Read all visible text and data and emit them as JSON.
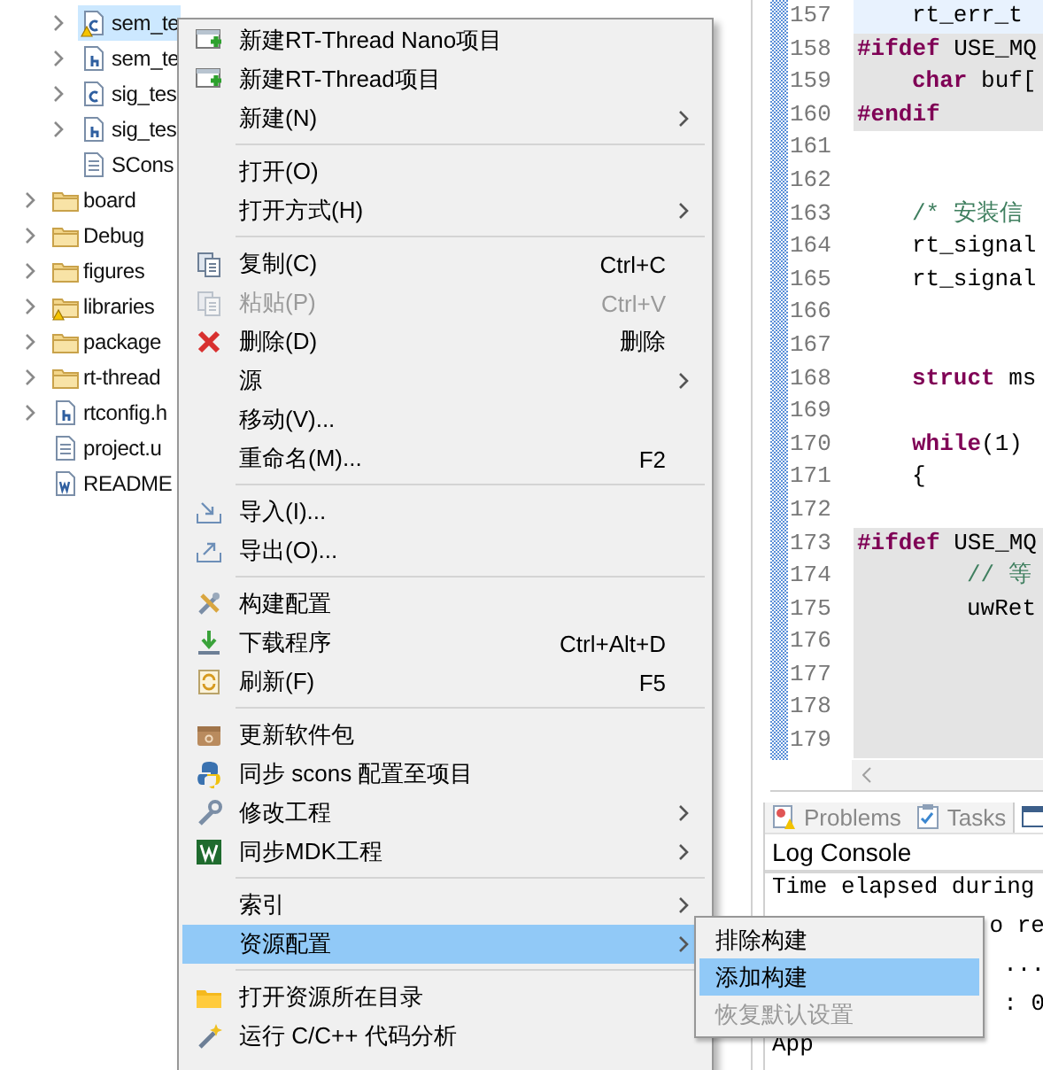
{
  "tree": {
    "open_folder_children": [
      {
        "label": "sem_te",
        "kind": "c-file",
        "warning": true,
        "expandable": true,
        "selected": true
      },
      {
        "label": "sem_te",
        "kind": "h-file",
        "warning": false,
        "expandable": true,
        "selected": false
      },
      {
        "label": "sig_tes",
        "kind": "c-file",
        "warning": false,
        "expandable": true,
        "selected": false
      },
      {
        "label": "sig_tes",
        "kind": "h-file",
        "warning": false,
        "expandable": true,
        "selected": false
      },
      {
        "label": "SCons",
        "kind": "text-file",
        "warning": false,
        "expandable": false,
        "selected": false
      }
    ],
    "items": [
      {
        "label": "board",
        "kind": "folder",
        "warning": false,
        "expandable": true,
        "selected": false
      },
      {
        "label": "Debug",
        "kind": "folder",
        "warning": false,
        "expandable": true,
        "selected": false
      },
      {
        "label": "figures",
        "kind": "folder",
        "warning": false,
        "expandable": true,
        "selected": false
      },
      {
        "label": "libraries",
        "kind": "folder",
        "warning": true,
        "expandable": true,
        "selected": false
      },
      {
        "label": "package",
        "kind": "folder",
        "warning": false,
        "expandable": true,
        "selected": false
      },
      {
        "label": "rt-thread",
        "kind": "folder",
        "warning": false,
        "expandable": true,
        "selected": false
      },
      {
        "label": "rtconfig.h",
        "kind": "h-file",
        "warning": false,
        "expandable": true,
        "selected": false
      },
      {
        "label": "project.u",
        "kind": "text-file",
        "warning": false,
        "expandable": false,
        "selected": false
      },
      {
        "label": "README",
        "kind": "word-file",
        "warning": false,
        "expandable": false,
        "selected": false
      }
    ]
  },
  "editor": {
    "lines": [
      {
        "number": "157",
        "kind": "inner",
        "current": true,
        "shaded": false,
        "tokens": [
          {
            "text": "rt_err_t",
            "kind": "plain"
          }
        ]
      },
      {
        "number": "158",
        "kind": "top",
        "current": false,
        "shaded": true,
        "tokens": [
          {
            "text": "#ifdef",
            "kind": "keyword"
          },
          {
            "text": " USE_MQ",
            "kind": "plain"
          }
        ]
      },
      {
        "number": "159",
        "kind": "inner",
        "current": false,
        "shaded": true,
        "tokens": [
          {
            "text": "char",
            "kind": "keyword"
          },
          {
            "text": " buf[",
            "kind": "plain"
          }
        ]
      },
      {
        "number": "160",
        "kind": "top",
        "current": false,
        "shaded": true,
        "tokens": [
          {
            "text": "#endif",
            "kind": "keyword"
          }
        ]
      },
      {
        "number": "161",
        "kind": "top",
        "current": false,
        "shaded": false
      },
      {
        "number": "162",
        "kind": "top",
        "current": false,
        "shaded": false
      },
      {
        "number": "163",
        "kind": "inner",
        "current": false,
        "shaded": false,
        "tokens": [
          {
            "text": "/* 安装信",
            "kind": "comment"
          }
        ]
      },
      {
        "number": "164",
        "kind": "inner",
        "current": false,
        "shaded": false,
        "tokens": [
          {
            "text": "rt_signal",
            "kind": "plain"
          }
        ]
      },
      {
        "number": "165",
        "kind": "inner",
        "current": false,
        "shaded": false,
        "tokens": [
          {
            "text": "rt_signal",
            "kind": "plain"
          }
        ]
      },
      {
        "number": "166",
        "kind": "top",
        "current": false,
        "shaded": false
      },
      {
        "number": "167",
        "kind": "top",
        "current": false,
        "shaded": false
      },
      {
        "number": "168",
        "kind": "inner",
        "current": false,
        "shaded": false,
        "tokens": [
          {
            "text": "struct",
            "kind": "keyword"
          },
          {
            "text": " ms",
            "kind": "plain"
          }
        ]
      },
      {
        "number": "169",
        "kind": "top",
        "current": false,
        "shaded": false
      },
      {
        "number": "170",
        "kind": "inner",
        "current": false,
        "shaded": false,
        "tokens": [
          {
            "text": "while",
            "kind": "keyword"
          },
          {
            "text": "(1)",
            "kind": "plain"
          }
        ]
      },
      {
        "number": "171",
        "kind": "inner",
        "current": false,
        "shaded": false,
        "tokens": [
          {
            "text": "{",
            "kind": "plain"
          }
        ]
      },
      {
        "number": "172",
        "kind": "top",
        "current": false,
        "shaded": false
      },
      {
        "number": "173",
        "kind": "top",
        "current": false,
        "shaded": true,
        "tokens": [
          {
            "text": "#ifdef",
            "kind": "keyword"
          },
          {
            "text": " USE_MQ",
            "kind": "plain"
          }
        ]
      },
      {
        "number": "174",
        "kind": "nested",
        "current": false,
        "shaded": true,
        "tokens": [
          {
            "text": "// 等",
            "kind": "comment"
          }
        ]
      },
      {
        "number": "175",
        "kind": "nested",
        "current": false,
        "shaded": true,
        "tokens": [
          {
            "text": "uwRet",
            "kind": "plain"
          }
        ]
      },
      {
        "number": "176",
        "kind": "top",
        "current": false,
        "shaded": true
      },
      {
        "number": "177",
        "kind": "top",
        "current": false,
        "shaded": true
      },
      {
        "number": "178",
        "kind": "top",
        "current": false,
        "shaded": true
      },
      {
        "number": "179",
        "kind": "top",
        "current": false,
        "shaded": true
      }
    ]
  },
  "bottom_panel": {
    "tabs": [
      {
        "label": "Problems",
        "selected": false
      },
      {
        "label": "Tasks",
        "selected": false
      },
      {
        "selected": true
      }
    ],
    "title": "Log Console",
    "lines": [
      {
        "text": "Time elapsed during",
        "covered": false
      },
      {
        "text": "o re",
        "covered": true
      },
      {
        "text": "...",
        "covered": true
      },
      {
        "text": ": 0",
        "covered": true
      },
      {
        "text": "App",
        "covered": false
      }
    ]
  },
  "context_menu": {
    "sections": [
      [
        {
          "label": "新建RT-Thread Nano项目",
          "submenu": false,
          "disabled": false,
          "selected": false
        },
        {
          "label": "新建RT-Thread项目",
          "submenu": false,
          "disabled": false,
          "selected": false
        },
        {
          "label": "新建(N)",
          "submenu": true,
          "disabled": false,
          "selected": false
        }
      ],
      [
        {
          "label": "打开(O)",
          "submenu": false,
          "disabled": false,
          "selected": false
        },
        {
          "label": "打开方式(H)",
          "submenu": true,
          "disabled": false,
          "selected": false
        }
      ],
      [
        {
          "label": "复制(C)",
          "shortcut": "Ctrl+C",
          "submenu": false,
          "disabled": false,
          "selected": false
        },
        {
          "label": "粘贴(P)",
          "shortcut": "Ctrl+V",
          "submenu": false,
          "disabled": true,
          "selected": false
        },
        {
          "label": "删除(D)",
          "shortcut": "删除",
          "submenu": false,
          "disabled": false,
          "selected": false
        },
        {
          "label": "源",
          "submenu": true,
          "disabled": false,
          "selected": false
        },
        {
          "label": "移动(V)...",
          "submenu": false,
          "disabled": false,
          "selected": false
        },
        {
          "label": "重命名(M)...",
          "shortcut": "F2",
          "submenu": false,
          "disabled": false,
          "selected": false
        }
      ],
      [
        {
          "label": "导入(I)...",
          "submenu": false,
          "disabled": false,
          "selected": false
        },
        {
          "label": "导出(O)...",
          "submenu": false,
          "disabled": false,
          "selected": false
        }
      ],
      [
        {
          "label": "构建配置",
          "submenu": false,
          "disabled": false,
          "selected": false
        },
        {
          "label": "下载程序",
          "shortcut": "Ctrl+Alt+D",
          "submenu": false,
          "disabled": false,
          "selected": false
        },
        {
          "label": "刷新(F)",
          "shortcut": "F5",
          "submenu": false,
          "disabled": false,
          "selected": false
        }
      ],
      [
        {
          "label": "更新软件包",
          "submenu": false,
          "disabled": false,
          "selected": false
        },
        {
          "label": "同步 scons 配置至项目",
          "submenu": false,
          "disabled": false,
          "selected": false
        },
        {
          "label": "修改工程",
          "submenu": true,
          "disabled": false,
          "selected": false
        },
        {
          "label": "同步MDK工程",
          "submenu": true,
          "disabled": false,
          "selected": false
        }
      ],
      [
        {
          "label": "索引",
          "submenu": true,
          "disabled": false,
          "selected": false
        },
        {
          "label": "资源配置",
          "submenu": true,
          "disabled": false,
          "selected": true
        }
      ],
      [
        {
          "label": "打开资源所在目录",
          "submenu": false,
          "disabled": false,
          "selected": false
        },
        {
          "label": "运行 C/C++ 代码分析",
          "submenu": false,
          "disabled": false,
          "selected": false
        }
      ]
    ]
  },
  "submenu": {
    "items": [
      {
        "label": "排除构建",
        "disabled": false,
        "selected": false
      },
      {
        "label": "添加构建",
        "disabled": false,
        "selected": true
      },
      {
        "label": "恢复默认设置",
        "disabled": true,
        "selected": false
      }
    ]
  }
}
